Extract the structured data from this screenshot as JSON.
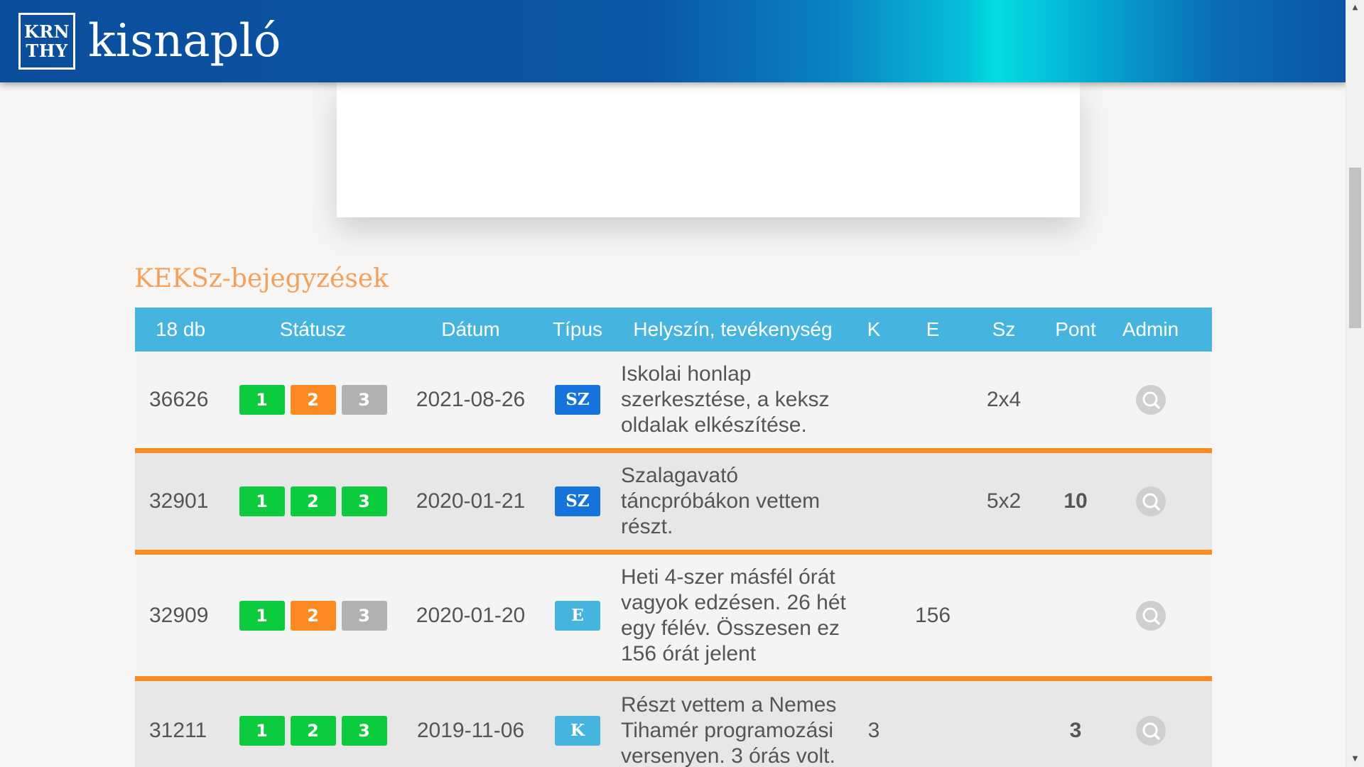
{
  "header": {
    "logo_line1": "KRN",
    "logo_line2": "THY",
    "title": "kisnapló"
  },
  "section": {
    "title": "KEKSz-bejegyzések"
  },
  "table": {
    "columns": {
      "count": "18 db",
      "status": "Státusz",
      "date": "Dátum",
      "type": "Típus",
      "desc": "Helyszín, tevékenység",
      "k": "K",
      "e": "E",
      "sz": "Sz",
      "points": "Pont",
      "admin": "Admin"
    },
    "rows": [
      {
        "id": "36626",
        "status": [
          {
            "label": "1",
            "color": "#0ccb3d"
          },
          {
            "label": "2",
            "color": "#fb8a23"
          },
          {
            "label": "3",
            "color": "#b1b1b1"
          }
        ],
        "date": "2021-08-26",
        "type": {
          "label": "SZ",
          "color": "#1574dc"
        },
        "desc": "Iskolai honlap szerkesztése, a keksz oldalak elkészítése.",
        "k": "",
        "e": "",
        "sz": "2x4",
        "points": "",
        "admin_icon": "search-icon"
      },
      {
        "id": "32901",
        "status": [
          {
            "label": "1",
            "color": "#0ccb3d"
          },
          {
            "label": "2",
            "color": "#0ccb3d"
          },
          {
            "label": "3",
            "color": "#0ccb3d"
          }
        ],
        "date": "2020-01-21",
        "type": {
          "label": "SZ",
          "color": "#1574dc"
        },
        "desc": "Szalagavató táncpróbákon vettem részt.",
        "k": "",
        "e": "",
        "sz": "5x2",
        "points": "10",
        "admin_icon": "search-icon"
      },
      {
        "id": "32909",
        "status": [
          {
            "label": "1",
            "color": "#0ccb3d"
          },
          {
            "label": "2",
            "color": "#fb8a23"
          },
          {
            "label": "3",
            "color": "#b1b1b1"
          }
        ],
        "date": "2020-01-20",
        "type": {
          "label": "E",
          "color": "#45b5e0"
        },
        "desc": "Heti 4-szer másfél órát vagyok edzésen. 26 hét egy félév. Összesen ez 156 órát jelent",
        "k": "",
        "e": "156",
        "sz": "",
        "points": "",
        "admin_icon": "search-icon"
      },
      {
        "id": "31211",
        "status": [
          {
            "label": "1",
            "color": "#0ccb3d"
          },
          {
            "label": "2",
            "color": "#0ccb3d"
          },
          {
            "label": "3",
            "color": "#0ccb3d"
          }
        ],
        "date": "2019-11-06",
        "type": {
          "label": "K",
          "color": "#45b5e0"
        },
        "desc": "Részt vettem a Nemes Tihamér programozási versenyen. 3 órás volt.",
        "k": "3",
        "e": "",
        "sz": "",
        "points": "3",
        "admin_icon": "search-icon"
      }
    ]
  }
}
